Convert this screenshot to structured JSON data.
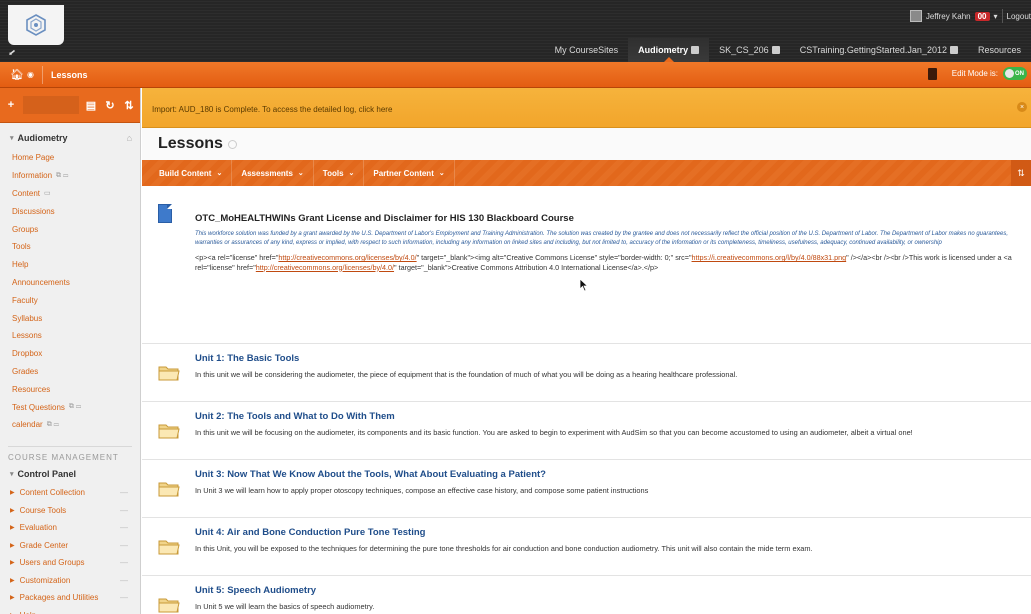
{
  "header": {
    "user": {
      "name": "Jeffrey Kahn",
      "notifications": "00",
      "logout": "Logout"
    },
    "tabs": [
      {
        "label": "My CourseSites",
        "active": false,
        "box": false
      },
      {
        "label": "Audiometry",
        "active": true,
        "box": true
      },
      {
        "label": "SK_CS_206",
        "active": false,
        "box": true
      },
      {
        "label": "CSTraining.GettingStarted.Jan_2012",
        "active": false,
        "box": true
      },
      {
        "label": "Resources",
        "active": false,
        "box": false
      }
    ]
  },
  "breadcrumb": {
    "label": "Lessons",
    "edit_mode_label": "Edit Mode is:",
    "edit_mode_state": "ON"
  },
  "sidebar": {
    "course_title": "Audiometry",
    "items": [
      {
        "label": "Home Page",
        "ext": ""
      },
      {
        "label": "Information",
        "ext": "⧉ ▭"
      },
      {
        "label": "Content",
        "ext": "▭"
      },
      {
        "label": "Discussions",
        "ext": ""
      },
      {
        "label": "Groups",
        "ext": ""
      },
      {
        "label": "Tools",
        "ext": ""
      },
      {
        "label": "Help",
        "ext": ""
      },
      {
        "label": "Announcements",
        "ext": ""
      },
      {
        "label": "Faculty",
        "ext": ""
      },
      {
        "label": "Syllabus",
        "ext": ""
      },
      {
        "label": "Lessons",
        "ext": ""
      },
      {
        "label": "Dropbox",
        "ext": ""
      },
      {
        "label": "Grades",
        "ext": ""
      },
      {
        "label": "Resources",
        "ext": ""
      },
      {
        "label": "Test Questions",
        "ext": "⧉ ▭"
      },
      {
        "label": "calendar",
        "ext": "⧉ ▭"
      }
    ],
    "course_management_title": "COURSE MANAGEMENT",
    "control_panel_label": "Control Panel",
    "control_panel_items": [
      {
        "label": "Content Collection"
      },
      {
        "label": "Course Tools"
      },
      {
        "label": "Evaluation"
      },
      {
        "label": "Grade Center"
      },
      {
        "label": "Users and Groups"
      },
      {
        "label": "Customization"
      },
      {
        "label": "Packages and Utilities"
      },
      {
        "label": "Help"
      }
    ]
  },
  "notice": {
    "text": "Import: AUD_180 is Complete. To access the detailed log, click here"
  },
  "main": {
    "page_title": "Lessons",
    "actions": [
      {
        "label": "Build Content"
      },
      {
        "label": "Assessments"
      },
      {
        "label": "Tools"
      },
      {
        "label": "Partner Content"
      }
    ],
    "license_item": {
      "title": "OTC_MoHEALTHWINs Grant License and Disclaimer for HIS 130 Blackboard Course",
      "disclaimer": "This workforce solution was funded by a grant awarded by the U.S. Department of Labor's Employment and Training Administration. The solution was created by the grantee and does not necessarily reflect the official position of the U.S. Department of Labor. The Department of Labor makes no guarantees, warranties or assurances of any kind, express or implied, with respect to such information, including any information on linked sites and including, but not limited to, accuracy of the information or its completeness, timeliness, usefulness, adequacy, continued availability, or ownership",
      "code_a": "<p><a rel=\"license\" href=\"",
      "code_link1": "http://creativecommons.org/licenses/by/4.0/",
      "code_b": "\" target=\"_blank\"><img alt=\"Creative Commons License\" style=\"border-width: 0;\" src=\"",
      "code_link2": "https://i.creativecommons.org/l/by/4.0/88x31.png",
      "code_c": "\" /></a><br /><br />This work is licensed under a <a rel=\"license\" href=\"",
      "code_link3": "http://creativecommons.org/licenses/by/4.0/",
      "code_d": "\" target=\"_blank\">Creative Commons Attribution 4.0 International License</a>.</p>"
    },
    "units": [
      {
        "title": "Unit 1: The Basic Tools",
        "desc": "In this unit we will be considering the audiometer, the piece of equipment that is the foundation of much of what you will be doing as a hearing healthcare professional."
      },
      {
        "title": "Unit 2: The Tools and What to Do With Them",
        "desc": "In this unit we will be focusing on the audiometer, its components and its basic function.  You are asked to begin to experiment with AudSim so that you can become accustomed to using an audiometer, albeit a virtual one!"
      },
      {
        "title": "Unit 3: Now That We Know About the Tools, What About Evaluating a Patient?",
        "desc": "In Unit 3 we will learn how to apply proper otoscopy techniques, compose an effective case history, and compose some patient instructions"
      },
      {
        "title": "Unit 4: Air and Bone Conduction Pure Tone Testing",
        "desc": "In this Unit, you will be exposed to the techniques for determining the pure tone thresholds for air conduction and bone conduction audiometry.  This unit will also contain the mide term exam."
      },
      {
        "title": "Unit 5: Speech Audiometry",
        "desc": "In Unit 5 we will learn the basics of speech audiometry."
      }
    ]
  },
  "colors": {
    "accent": "#e86a1e",
    "link": "#d46418",
    "unit_title": "#1f4d8a",
    "notice": "#f2a52b",
    "header": "#262626"
  }
}
